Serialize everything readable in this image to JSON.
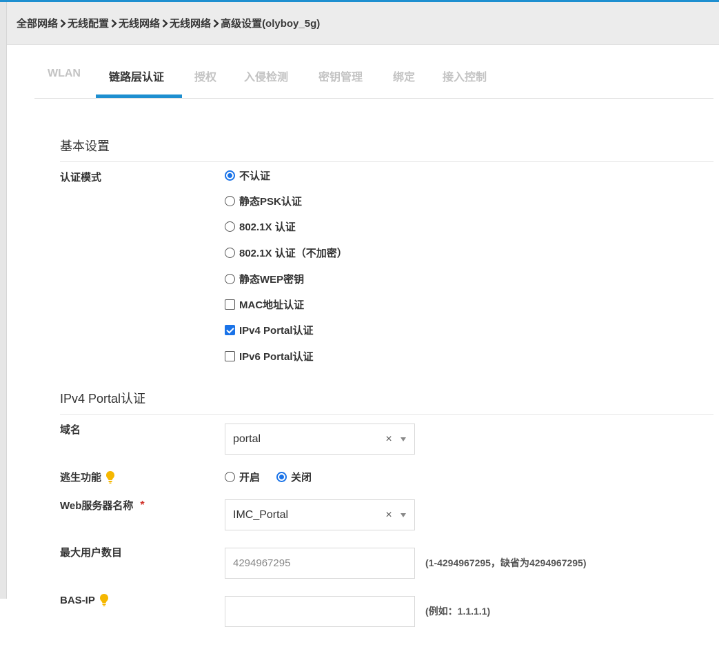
{
  "breadcrumb": [
    "全部网络",
    "无线配置",
    "无线网络",
    "无线网络",
    "高级设置(olyboy_5g)"
  ],
  "tabs": [
    {
      "label": "WLAN",
      "active": false
    },
    {
      "label": "链路层认证",
      "active": true
    },
    {
      "label": "授权",
      "active": false
    },
    {
      "label": "入侵检测",
      "active": false
    },
    {
      "label": "密钥管理",
      "active": false
    },
    {
      "label": "绑定",
      "active": false
    },
    {
      "label": "接入控制",
      "active": false
    }
  ],
  "basic": {
    "title": "基本设置",
    "auth_mode_label": "认证模式",
    "options": [
      {
        "label": "不认证",
        "type": "radio",
        "checked": true
      },
      {
        "label": "静态PSK认证",
        "type": "radio",
        "checked": false
      },
      {
        "label": "802.1X 认证",
        "type": "radio",
        "checked": false
      },
      {
        "label": "802.1X 认证（不加密）",
        "type": "radio",
        "checked": false
      },
      {
        "label": "静态WEP密钥",
        "type": "radio",
        "checked": false
      },
      {
        "label": "MAC地址认证",
        "type": "checkbox",
        "checked": false
      },
      {
        "label": "IPv4 Portal认证",
        "type": "checkbox",
        "checked": true
      },
      {
        "label": "IPv6 Portal认证",
        "type": "checkbox",
        "checked": false
      }
    ]
  },
  "portal": {
    "title": "IPv4 Portal认证",
    "domain_label": "域名",
    "domain_value": "portal",
    "escape_label": "逃生功能",
    "escape_on": "开启",
    "escape_off": "关闭",
    "escape_selected": "off",
    "web_server_label": "Web服务器名称",
    "required_mark": "*",
    "web_server_value": "IMC_Portal",
    "max_users_label": "最大用户数目",
    "max_users_value": "4294967295",
    "max_users_hint": "(1-4294967295，缺省为4294967295)",
    "bas_ip_label": "BAS-IP",
    "bas_ip_value": "",
    "bas_ip_hint": "(例如：1.1.1.1)"
  },
  "colors": {
    "accent": "#1e8fd0",
    "radio_blue": "#1a73e8",
    "bulb": "#f5b700",
    "required": "#d0342c"
  },
  "icons": {
    "separator": "chevron-right-icon",
    "tip": "lightbulb-icon",
    "clear": "clear-icon",
    "dropdown": "caret-down-icon"
  }
}
